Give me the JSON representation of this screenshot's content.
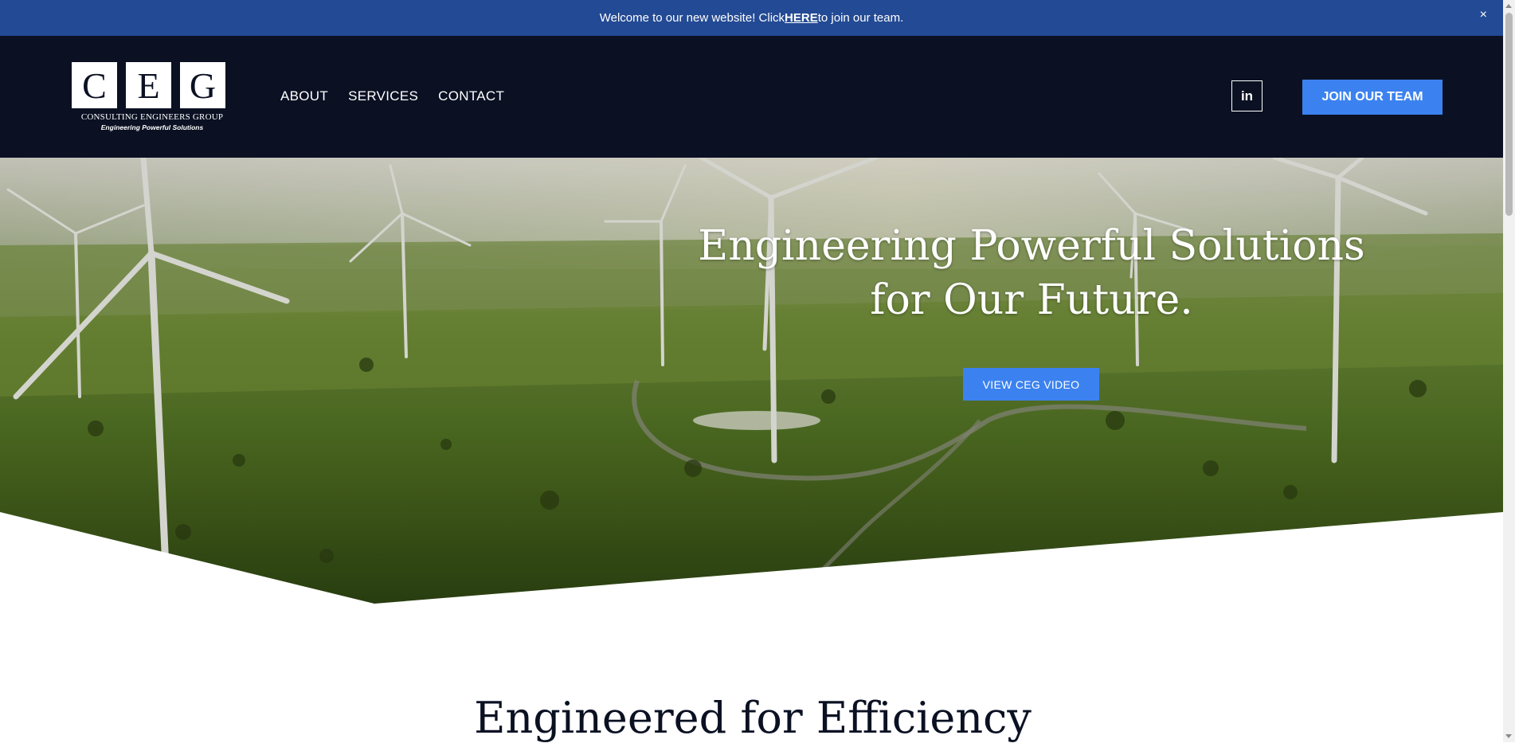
{
  "announcement": {
    "text_before": "Welcome to our new website! Click ",
    "link_text": "HERE",
    "text_after": " to join our team.",
    "close_label": "×"
  },
  "logo": {
    "letters": [
      "C",
      "E",
      "G"
    ],
    "company_name": "CONSULTING ENGINEERS GROUP",
    "tagline": "Engineering Powerful Solutions"
  },
  "nav": {
    "items": [
      {
        "label": "ABOUT"
      },
      {
        "label": "SERVICES"
      },
      {
        "label": "CONTACT"
      }
    ]
  },
  "header": {
    "linkedin_label": "in",
    "cta_label": "JOIN OUR TEAM"
  },
  "hero": {
    "title": "Engineering Powerful Solutions for Our Future.",
    "button_label": "VIEW CEG VIDEO"
  },
  "section": {
    "heading": "Engineered for Efficiency"
  },
  "colors": {
    "announcement_bg": "#234a94",
    "header_bg": "#0b1123",
    "accent": "#3b82f0",
    "text_dark": "#0b1123"
  },
  "icons": [
    "close-icon",
    "linkedin-icon",
    "scrollbar-up-arrow-icon",
    "scrollbar-down-arrow-icon"
  ]
}
